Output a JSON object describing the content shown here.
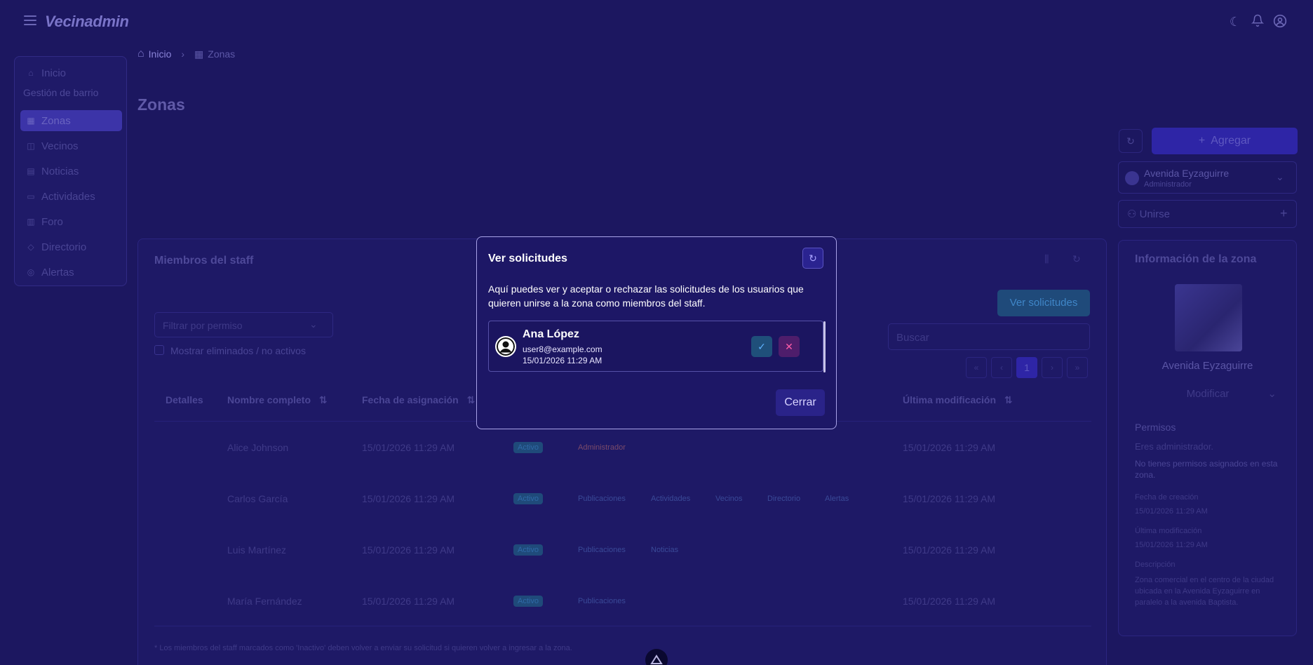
{
  "app": {
    "brand": "Vecinadmin"
  },
  "breadcrumb": {
    "home": "Inicio",
    "separator": "›",
    "current": "Zonas"
  },
  "sidebar": {
    "home": "Inicio",
    "section": "Gestión de barrio",
    "items": [
      {
        "label": "Zonas",
        "icon": "building-icon"
      },
      {
        "label": "Vecinos",
        "icon": "users-icon"
      },
      {
        "label": "Noticias",
        "icon": "news-icon"
      },
      {
        "label": "Actividades",
        "icon": "activity-icon"
      },
      {
        "label": "Foro",
        "icon": "forum-icon"
      },
      {
        "label": "Directorio",
        "icon": "directory-icon"
      },
      {
        "label": "Alertas",
        "icon": "alert-icon"
      }
    ]
  },
  "page": {
    "title": "Zonas"
  },
  "controls": {
    "add_label": "Agregar",
    "user_name": "Avenida Eyzaguirre",
    "user_role": "Administrador",
    "join_label": "Unirse"
  },
  "staff": {
    "title": "Miembros del staff",
    "filter_placeholder": "Filtrar por permiso",
    "show_deleted": "Mostrar eliminados / no activos",
    "view_requests": "Ver solicitudes",
    "search_placeholder": "Buscar",
    "page": "1",
    "headers": [
      "Detalles",
      "Nombre completo",
      "Fecha de asignación",
      "Última modificación"
    ],
    "rows": [
      {
        "name": "Alice Johnson",
        "assigned": "15/01/2026 11:29 AM",
        "modified": "15/01/2026 11:29 AM",
        "tags": [
          "Activo",
          "Administrador"
        ]
      },
      {
        "name": "Carlos García",
        "assigned": "15/01/2026 11:29 AM",
        "modified": "15/01/2026 11:29 AM",
        "tags": [
          "Activo",
          "Publicaciones",
          "Actividades",
          "Vecinos",
          "Directorio",
          "Alertas"
        ]
      },
      {
        "name": "Luis Martínez",
        "assigned": "15/01/2026 11:29 AM",
        "modified": "15/01/2026 11:29 AM",
        "tags": [
          "Activo",
          "Publicaciones",
          "Noticias"
        ]
      },
      {
        "name": "María Fernández",
        "assigned": "15/01/2026 11:29 AM",
        "modified": "15/01/2026 11:29 AM",
        "tags": [
          "Activo",
          "Publicaciones"
        ]
      }
    ],
    "footnote": "* Los miembros del staff marcados como 'Inactivo' deben volver a enviar su solicitud si quieren volver a ingresar a la zona."
  },
  "zone_info": {
    "title": "Información de la zona",
    "name": "Avenida Eyzaguirre",
    "modify": "Modificar",
    "permissions_title": "Permisos",
    "admin_note": "Eres administrador.",
    "no_permissions": "No tienes permisos asignados en esta zona.",
    "created_label": "Fecha de creación",
    "created_value": "15/01/2026 11:29 AM",
    "modified_label": "Última modificación",
    "modified_value": "15/01/2026 11:29 AM",
    "description_label": "Descripción",
    "description": "Zona comercial en el centro de la ciudad ubicada en la Avenida Eyzaguirre en paralelo a la avenida Baptista."
  },
  "modal": {
    "title": "Ver solicitudes",
    "description": "Aquí puedes ver y aceptar o rechazar las solicitudes de los usuarios que quieren unirse a la zona como miembros del staff.",
    "request": {
      "name": "Ana López",
      "email": "user8@example.com",
      "date": "15/01/2026 11:29 AM"
    },
    "close_label": "Cerrar"
  },
  "colors": {
    "background": "#1c1760",
    "accent": "#2e25a6",
    "accept": "#5fb2ff",
    "reject": "#ff5da8"
  }
}
